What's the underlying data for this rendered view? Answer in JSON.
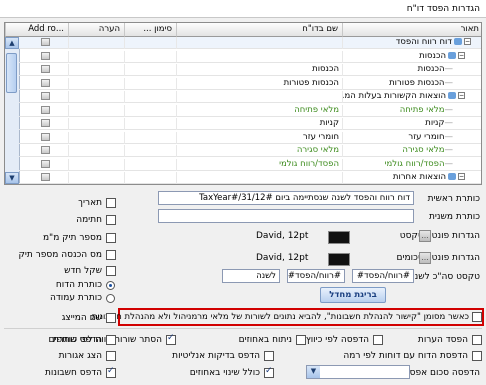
{
  "window": {
    "title": "הגדרות הפסד דו\"ח"
  },
  "grid": {
    "columns": {
      "c1": "תאור",
      "c2": "שם בדו\"ח",
      "c3": "סימון ...",
      "c4": "הערה",
      "c5": "...Add ro"
    },
    "rows": [
      {
        "desc": "דוח רווח והפסד",
        "report": "",
        "type": "root",
        "checked": false
      },
      {
        "desc": "הכנסות",
        "report": "",
        "type": "group",
        "checked": false
      },
      {
        "desc": "הכנסות",
        "report": "הכנסות",
        "type": "leaf",
        "checked": false
      },
      {
        "desc": "הכנסות פטורות",
        "report": "הכנסות פטורות",
        "type": "leaf",
        "checked": false
      },
      {
        "desc": "הוצאות הקשורות בעלות המ...",
        "report": "",
        "type": "group",
        "checked": false
      },
      {
        "desc": "מלאי פתיחה",
        "report": "מלאי פתיחה",
        "type": "leaf-green",
        "checked": false
      },
      {
        "desc": "קניות",
        "report": "קניות",
        "type": "leaf",
        "checked": false
      },
      {
        "desc": "חומרי עזר",
        "report": "חומרי עזר",
        "type": "leaf",
        "checked": false
      },
      {
        "desc": "מלאי סגירה",
        "report": "מלאי סגירה",
        "type": "leaf-green",
        "checked": false
      },
      {
        "desc": "הפסד/רווח גולמי",
        "report": "הפסד/רווח גולמי",
        "type": "leaf-green",
        "checked": false
      },
      {
        "desc": "הוצאות אחרות",
        "report": "",
        "type": "group",
        "checked": false
      }
    ]
  },
  "form": {
    "main_title_label": "כותרת ראשית",
    "main_title_value": "דוח רווח והפסד לשנה שנסתיימה ביום #TaxYear#/31/12",
    "sub_title_label": "כותרת משנית",
    "sub_title_value": "",
    "text_font_label": "הגדרות פונט לטקסט",
    "text_font_value": "David, 12pt",
    "sum_font_label": "הגדרות פונט לסכומים",
    "sum_font_value": "David, 12pt",
    "year_text_label": "טקסט סה\"כ לשנה",
    "year_field_1": "#רווח/הפסד#",
    "year_field_2": "#רווח/הפסד#",
    "year_field_3": "לשנה",
    "new_button": "בריגת מחדל",
    "left_options": [
      {
        "label": "תאריך",
        "checked": false
      },
      {
        "label": "חתימה",
        "checked": false
      },
      {
        "label": "מספר תיק מ\"מ",
        "checked": false
      },
      {
        "label": "מס הכנסה מספר תיק",
        "checked": false
      },
      {
        "label": "שקל חדש",
        "checked": false
      }
    ],
    "radio_row_title": "כותרת הדוח",
    "radio_column_title": "כותרת עמודה",
    "highlight_option": "כאשר מסומן \"קישור להנהלת חשבונות\", להביא נתונים לשורות של מלאי מרמניהול ולא מהנהלת חשבונות",
    "sham_option": "שם המייצג",
    "bottom_row1": [
      "הפסד הערות",
      "הדפסה לפי כיווץ",
      "ניתוח באחוזים",
      "הסתר שורות רווח לפי כותרת",
      "הדפס שותפים"
    ],
    "bottom_row2": [
      "הדפסת הדוח עם דוחות לפי רמה",
      "הדפס בדיקות אנליטיות",
      "הצג אגורות"
    ],
    "bottom_row3": [
      "הדפסה סכום אפס",
      "כולל שינוי באחוזים",
      "הדפס חשבונות"
    ]
  },
  "colors": {
    "accent": "#1a4fa0",
    "highlight_border": "#d10000",
    "green_text": "#3a8a1a"
  }
}
